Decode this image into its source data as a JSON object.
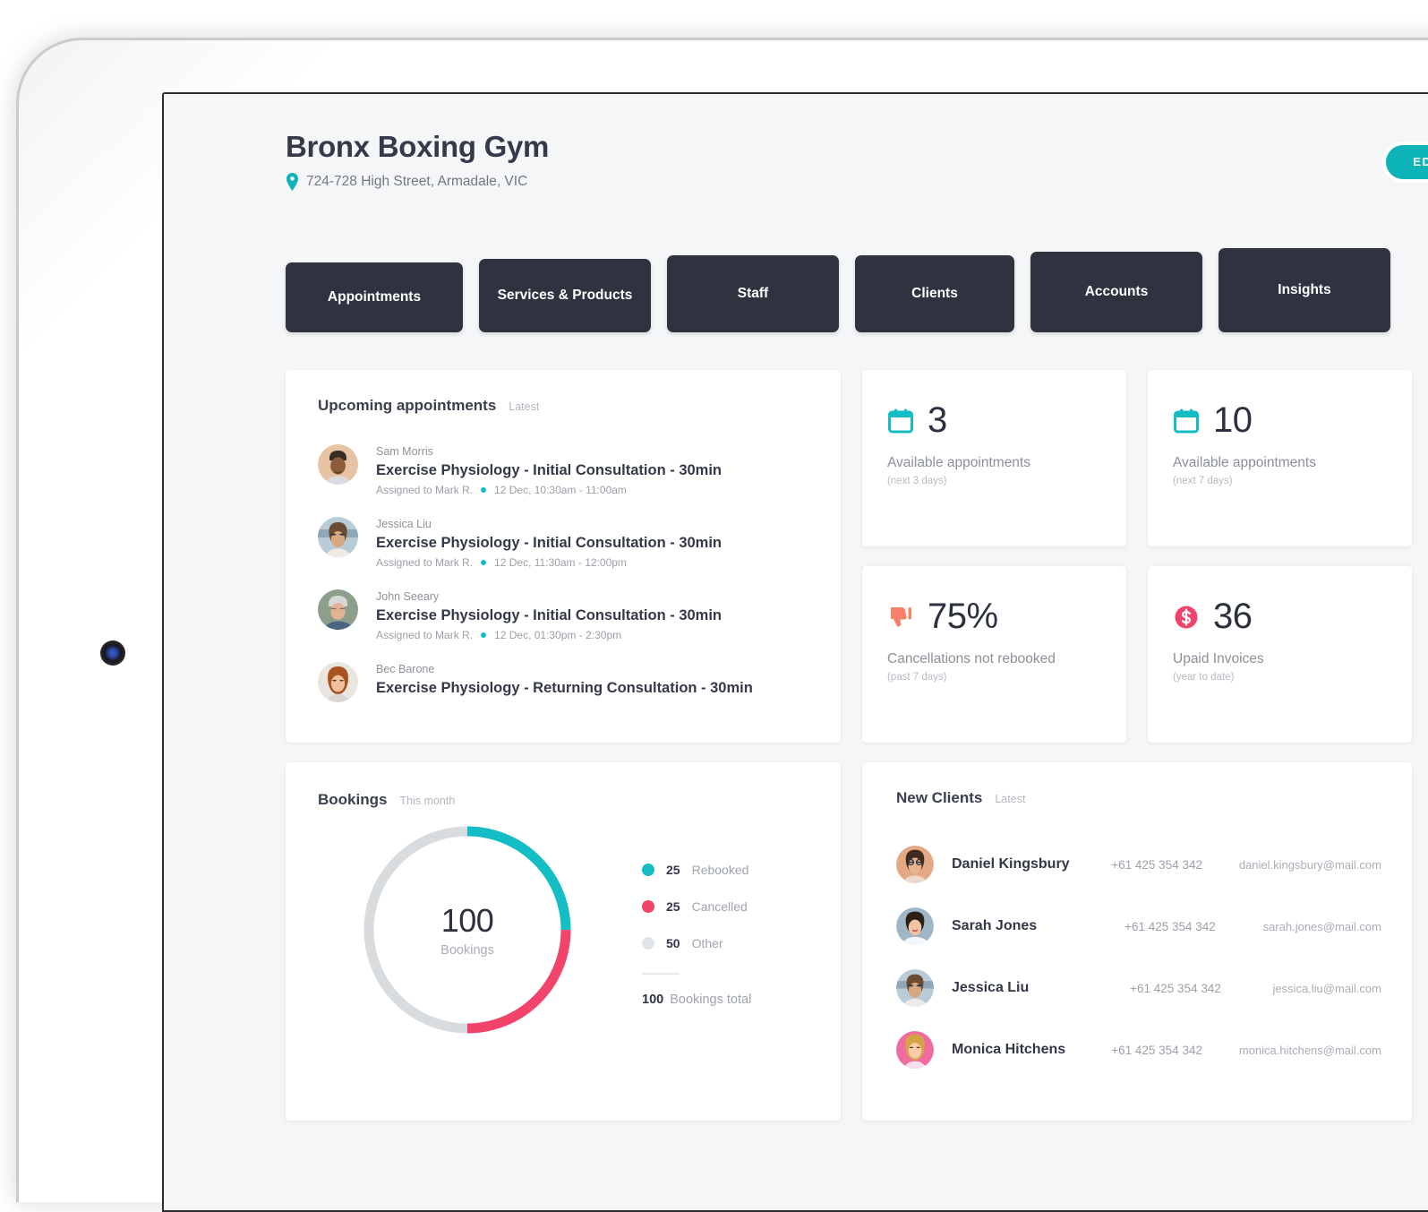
{
  "colors": {
    "teal": "#0cb3b8",
    "teal_chart": "#14bcc4",
    "pink": "#f2436a",
    "grey": "#d9dcdf",
    "coral": "#f98068",
    "dark_navy": "#2f3340",
    "page_bg": "#f4f6f7"
  },
  "header": {
    "title": "Bronx Boxing Gym",
    "address": "724-728 High Street, Armadale, VIC",
    "pin_icon": "location-pin-icon",
    "edit_profile_label": "EDIT PROFILE"
  },
  "tabs": [
    {
      "label": "Appointments"
    },
    {
      "label": "Services & Products"
    },
    {
      "label": "Staff"
    },
    {
      "label": "Clients"
    },
    {
      "label": "Accounts"
    },
    {
      "label": "Insights"
    }
  ],
  "appointments_card": {
    "heading": "Upcoming appointments",
    "heading_sub": "Latest",
    "items": [
      {
        "client": "Sam Morris",
        "service": "Exercise Physiology - Initial Consultation - 30min",
        "assigned": "Assigned to Mark R.",
        "time": "12 Dec, 10:30am - 11:00am"
      },
      {
        "client": "Jessica Liu",
        "service": "Exercise Physiology - Initial Consultation - 30min",
        "assigned": "Assigned to Mark R.",
        "time": "12 Dec, 11:30am - 12:00pm"
      },
      {
        "client": "John Seeary",
        "service": "Exercise Physiology - Initial Consultation - 30min",
        "assigned": "Assigned to Mark R.",
        "time": "12 Dec, 01:30pm - 2:30pm"
      },
      {
        "client": "Bec Barone",
        "service": "Exercise Physiology - Returning Consultation - 30min",
        "assigned": "",
        "time": ""
      }
    ]
  },
  "stats": [
    {
      "icon": "calendar-icon",
      "value": "3",
      "label": "Available appointments",
      "sub": "(next 3 days)",
      "icon_color": "#14bcc4"
    },
    {
      "icon": "calendar-icon",
      "value": "10",
      "label": "Available appointments",
      "sub": "(next 7 days)",
      "icon_color": "#14bcc4"
    },
    {
      "icon": "thumbs-down-icon",
      "value": "75%",
      "label": "Cancellations not rebooked",
      "sub": "(past 7 days)",
      "icon_color": "#f98068"
    },
    {
      "icon": "dollar-badge-icon",
      "value": "36",
      "label": "Upaid Invoices",
      "sub": "(year to date)",
      "icon_color": "#f2436a"
    }
  ],
  "bookings_card": {
    "heading": "Bookings",
    "heading_sub": "This month",
    "center_value": "100",
    "center_label": "Bookings",
    "total_value": "100",
    "total_label": "Bookings total"
  },
  "chart_data": {
    "type": "pie",
    "title": "Bookings",
    "subtitle": "This month",
    "total": 100,
    "total_label": "Bookings total",
    "center_value": 100,
    "center_label": "Bookings",
    "donut": true,
    "start_angle_deg": 0,
    "legend_position": "right",
    "categories": [
      "Rebooked",
      "Cancelled",
      "Other"
    ],
    "values": [
      25,
      25,
      50
    ],
    "colors": [
      "#14bcc4",
      "#f2436a",
      "#d9dcdf"
    ]
  },
  "clients_card": {
    "heading": "New Clients",
    "heading_sub": "Latest",
    "rows": [
      {
        "name": "Daniel Kingsbury",
        "phone": "+61 425 354 342",
        "email": "daniel.kingsbury@mail.com"
      },
      {
        "name": "Sarah Jones",
        "phone": "+61 425 354 342",
        "email": "sarah.jones@mail.com"
      },
      {
        "name": "Jessica Liu",
        "phone": "+61 425 354 342",
        "email": "jessica.liu@mail.com"
      },
      {
        "name": "Monica Hitchens",
        "phone": "+61 425 354 342",
        "email": "monica.hitchens@mail.com"
      }
    ]
  }
}
